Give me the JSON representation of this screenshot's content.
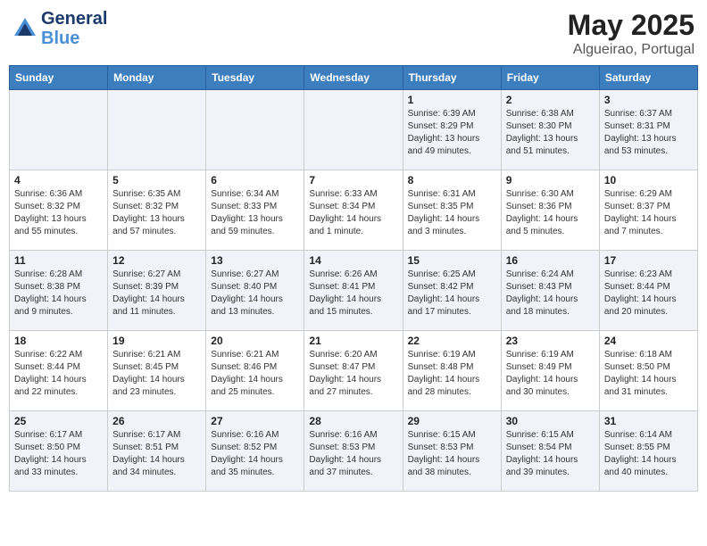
{
  "header": {
    "logo_line1": "General",
    "logo_line2": "Blue",
    "month": "May 2025",
    "location": "Algueirao, Portugal"
  },
  "weekdays": [
    "Sunday",
    "Monday",
    "Tuesday",
    "Wednesday",
    "Thursday",
    "Friday",
    "Saturday"
  ],
  "weeks": [
    [
      {
        "day": "",
        "info": ""
      },
      {
        "day": "",
        "info": ""
      },
      {
        "day": "",
        "info": ""
      },
      {
        "day": "",
        "info": ""
      },
      {
        "day": "1",
        "info": "Sunrise: 6:39 AM\nSunset: 8:29 PM\nDaylight: 13 hours\nand 49 minutes."
      },
      {
        "day": "2",
        "info": "Sunrise: 6:38 AM\nSunset: 8:30 PM\nDaylight: 13 hours\nand 51 minutes."
      },
      {
        "day": "3",
        "info": "Sunrise: 6:37 AM\nSunset: 8:31 PM\nDaylight: 13 hours\nand 53 minutes."
      }
    ],
    [
      {
        "day": "4",
        "info": "Sunrise: 6:36 AM\nSunset: 8:32 PM\nDaylight: 13 hours\nand 55 minutes."
      },
      {
        "day": "5",
        "info": "Sunrise: 6:35 AM\nSunset: 8:32 PM\nDaylight: 13 hours\nand 57 minutes."
      },
      {
        "day": "6",
        "info": "Sunrise: 6:34 AM\nSunset: 8:33 PM\nDaylight: 13 hours\nand 59 minutes."
      },
      {
        "day": "7",
        "info": "Sunrise: 6:33 AM\nSunset: 8:34 PM\nDaylight: 14 hours\nand 1 minute."
      },
      {
        "day": "8",
        "info": "Sunrise: 6:31 AM\nSunset: 8:35 PM\nDaylight: 14 hours\nand 3 minutes."
      },
      {
        "day": "9",
        "info": "Sunrise: 6:30 AM\nSunset: 8:36 PM\nDaylight: 14 hours\nand 5 minutes."
      },
      {
        "day": "10",
        "info": "Sunrise: 6:29 AM\nSunset: 8:37 PM\nDaylight: 14 hours\nand 7 minutes."
      }
    ],
    [
      {
        "day": "11",
        "info": "Sunrise: 6:28 AM\nSunset: 8:38 PM\nDaylight: 14 hours\nand 9 minutes."
      },
      {
        "day": "12",
        "info": "Sunrise: 6:27 AM\nSunset: 8:39 PM\nDaylight: 14 hours\nand 11 minutes."
      },
      {
        "day": "13",
        "info": "Sunrise: 6:27 AM\nSunset: 8:40 PM\nDaylight: 14 hours\nand 13 minutes."
      },
      {
        "day": "14",
        "info": "Sunrise: 6:26 AM\nSunset: 8:41 PM\nDaylight: 14 hours\nand 15 minutes."
      },
      {
        "day": "15",
        "info": "Sunrise: 6:25 AM\nSunset: 8:42 PM\nDaylight: 14 hours\nand 17 minutes."
      },
      {
        "day": "16",
        "info": "Sunrise: 6:24 AM\nSunset: 8:43 PM\nDaylight: 14 hours\nand 18 minutes."
      },
      {
        "day": "17",
        "info": "Sunrise: 6:23 AM\nSunset: 8:44 PM\nDaylight: 14 hours\nand 20 minutes."
      }
    ],
    [
      {
        "day": "18",
        "info": "Sunrise: 6:22 AM\nSunset: 8:44 PM\nDaylight: 14 hours\nand 22 minutes."
      },
      {
        "day": "19",
        "info": "Sunrise: 6:21 AM\nSunset: 8:45 PM\nDaylight: 14 hours\nand 23 minutes."
      },
      {
        "day": "20",
        "info": "Sunrise: 6:21 AM\nSunset: 8:46 PM\nDaylight: 14 hours\nand 25 minutes."
      },
      {
        "day": "21",
        "info": "Sunrise: 6:20 AM\nSunset: 8:47 PM\nDaylight: 14 hours\nand 27 minutes."
      },
      {
        "day": "22",
        "info": "Sunrise: 6:19 AM\nSunset: 8:48 PM\nDaylight: 14 hours\nand 28 minutes."
      },
      {
        "day": "23",
        "info": "Sunrise: 6:19 AM\nSunset: 8:49 PM\nDaylight: 14 hours\nand 30 minutes."
      },
      {
        "day": "24",
        "info": "Sunrise: 6:18 AM\nSunset: 8:50 PM\nDaylight: 14 hours\nand 31 minutes."
      }
    ],
    [
      {
        "day": "25",
        "info": "Sunrise: 6:17 AM\nSunset: 8:50 PM\nDaylight: 14 hours\nand 33 minutes."
      },
      {
        "day": "26",
        "info": "Sunrise: 6:17 AM\nSunset: 8:51 PM\nDaylight: 14 hours\nand 34 minutes."
      },
      {
        "day": "27",
        "info": "Sunrise: 6:16 AM\nSunset: 8:52 PM\nDaylight: 14 hours\nand 35 minutes."
      },
      {
        "day": "28",
        "info": "Sunrise: 6:16 AM\nSunset: 8:53 PM\nDaylight: 14 hours\nand 37 minutes."
      },
      {
        "day": "29",
        "info": "Sunrise: 6:15 AM\nSunset: 8:53 PM\nDaylight: 14 hours\nand 38 minutes."
      },
      {
        "day": "30",
        "info": "Sunrise: 6:15 AM\nSunset: 8:54 PM\nDaylight: 14 hours\nand 39 minutes."
      },
      {
        "day": "31",
        "info": "Sunrise: 6:14 AM\nSunset: 8:55 PM\nDaylight: 14 hours\nand 40 minutes."
      }
    ]
  ]
}
